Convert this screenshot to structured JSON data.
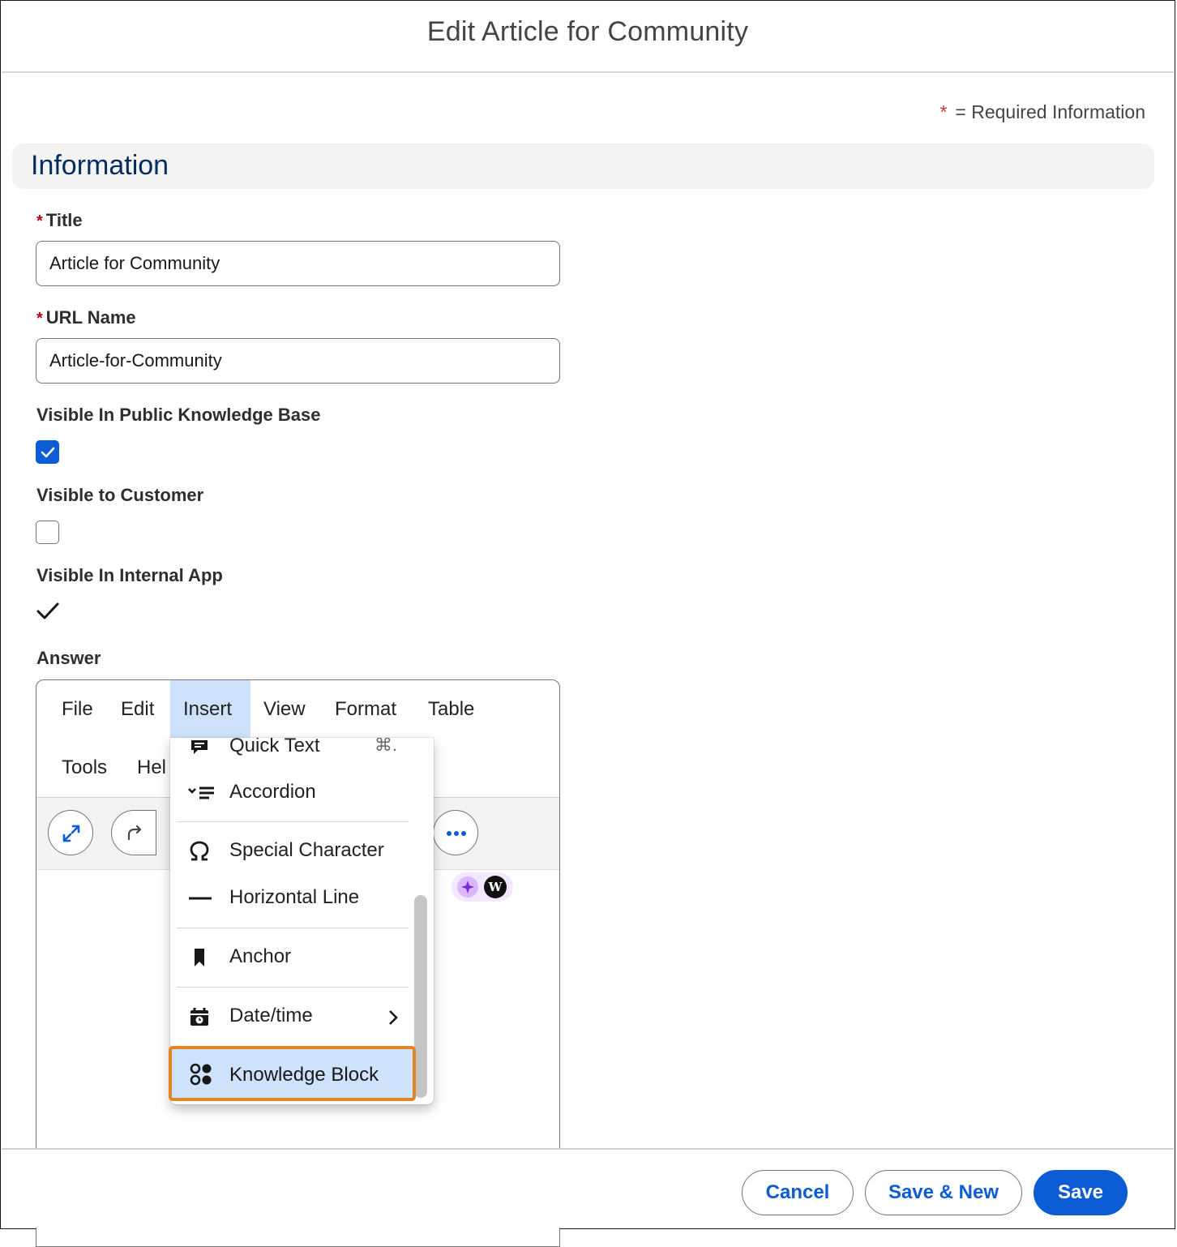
{
  "modal": {
    "title": "Edit Article for Community",
    "required_star": "*",
    "required_legend": "= Required Information"
  },
  "section": {
    "title": "Information"
  },
  "fields": {
    "title": {
      "star": "*",
      "label": "Title",
      "value": "Article for Community"
    },
    "url_name": {
      "star": "*",
      "label": "URL Name",
      "value": "Article-for-Community"
    },
    "visible_public_kb": {
      "label": "Visible In Public Knowledge Base",
      "checked": true
    },
    "visible_customer": {
      "label": "Visible to Customer",
      "checked": false
    },
    "visible_internal": {
      "label": "Visible In Internal App",
      "checked": true
    },
    "answer": {
      "label": "Answer"
    }
  },
  "editor": {
    "menubar": [
      "File",
      "Edit",
      "Insert",
      "View",
      "Format",
      "Table",
      "Tools",
      "Hel"
    ],
    "active_menu": "Insert",
    "toolbar_icons": [
      "fullscreen-icon",
      "redo-icon",
      "more-icon"
    ]
  },
  "insert_menu": {
    "items": [
      {
        "label": "Quick Text",
        "shortcut": "⌘.",
        "icon": "quick-text-icon"
      },
      {
        "label": "Accordion",
        "icon": "accordion-icon"
      },
      {
        "label": "Special Character",
        "icon": "omega-icon"
      },
      {
        "label": "Horizontal Line",
        "icon": "horizontal-line-icon"
      },
      {
        "label": "Anchor",
        "icon": "bookmark-icon"
      },
      {
        "label": "Date/time",
        "icon": "calendar-icon",
        "submenu": true
      },
      {
        "label": "Knowledge Block",
        "icon": "knowledge-block-icon",
        "highlighted": true
      }
    ]
  },
  "ai_badge": {
    "letter": "W"
  },
  "footer": {
    "cancel": "Cancel",
    "save_new": "Save & New",
    "save": "Save"
  },
  "colors": {
    "brand": "#0b5cd5",
    "highlight_border": "#e38422",
    "active_menu_bg": "#cfe2fc",
    "required": "#ba0517"
  }
}
